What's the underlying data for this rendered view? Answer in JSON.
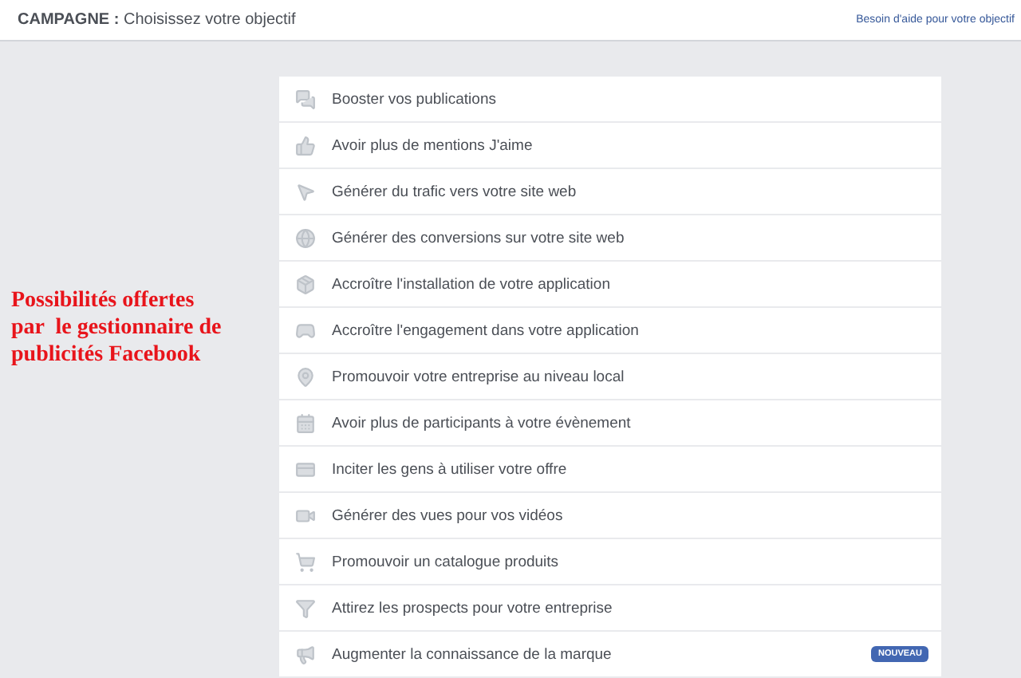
{
  "header": {
    "label": "CAMPAGNE :",
    "title": "Choisissez votre objectif",
    "help_link": "Besoin d'aide pour votre objectif"
  },
  "annotation": {
    "lines": [
      "Possibilités offertes",
      "par  le gestionnaire de",
      "publicités Facebook"
    ]
  },
  "objectives": [
    {
      "label": "Booster vos publications"
    },
    {
      "label": "Avoir plus de mentions J'aime"
    },
    {
      "label": "Générer du trafic vers votre site web"
    },
    {
      "label": "Générer des conversions sur votre site web"
    },
    {
      "label": "Accroître l'installation de votre application"
    },
    {
      "label": "Accroître l'engagement dans votre application"
    },
    {
      "label": "Promouvoir votre entreprise au niveau local"
    },
    {
      "label": "Avoir plus de participants à votre évènement"
    },
    {
      "label": "Inciter les gens à utiliser votre offre"
    },
    {
      "label": "Générer des vues pour vos vidéos"
    },
    {
      "label": "Promouvoir un catalogue produits"
    },
    {
      "label": "Attirez les prospects pour votre entreprise"
    },
    {
      "label": "Augmenter la connaissance de la marque",
      "badge": "NOUVEAU"
    }
  ]
}
